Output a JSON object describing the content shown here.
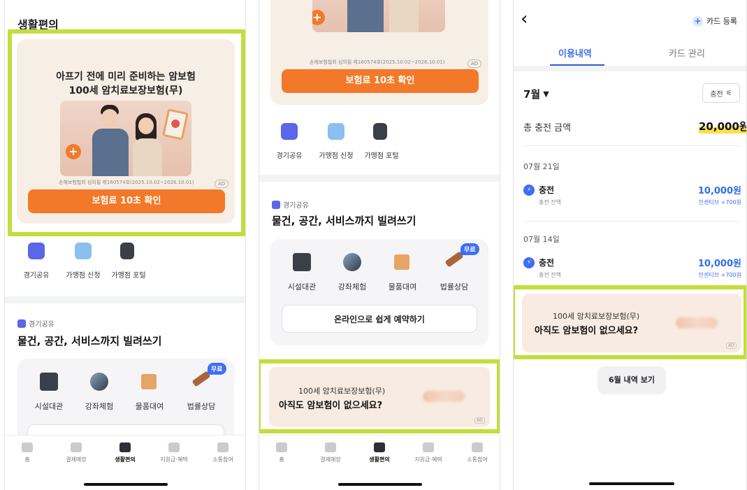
{
  "panel1": {
    "title": "생활편의",
    "ad": {
      "line1": "아프기 전에 미리 준비하는 암보험",
      "line2": "100세 암치료보장보험(무)",
      "caption": "손해보험협회 심의필 제160574호(2025.10.02~2026.10.01)",
      "badge": "AD",
      "cta": "보험료 10초 확인"
    },
    "quick": [
      "경기공유",
      "가맹점 신청",
      "가맹점 포털"
    ],
    "section_tag": "경기공유",
    "section_title": "물건, 공간, 서비스까지 빌려쓰기",
    "services": [
      "시설대관",
      "강좌체험",
      "물품대여",
      "법률상담"
    ],
    "free_badge": "무료"
  },
  "panel2": {
    "ad": {
      "caption": "손해보험협회 심의필 제160574호(2025.10.02~2026.10.01)",
      "badge": "AD",
      "cta": "보험료 10초 확인"
    },
    "quick": [
      "경기공유",
      "가맹점 신청",
      "가맹점 포털"
    ],
    "section_tag": "경기공유",
    "section_title": "물건, 공간, 서비스까지 빌려쓰기",
    "services": [
      "시설대관",
      "강좌체험",
      "물품대여",
      "법률상담"
    ],
    "free_badge": "무료",
    "reserve": "온라인으로 쉽게 예약하기",
    "banner": {
      "line1": "100세 암치료보장보험(무)",
      "line2": "아직도 암보험이 없으세요?",
      "badge": "AD"
    }
  },
  "tabs": [
    "홈",
    "결제매장",
    "생활편의",
    "지원금·혜택",
    "소통참여"
  ],
  "active_tab": "생활편의",
  "panel3": {
    "back": "‹",
    "register": "카드 등록",
    "tabs": [
      "이용내역",
      "카드 관리"
    ],
    "month": "7월",
    "filter": "충전",
    "total_label": "총 충전 금액",
    "total_value": "20,000원",
    "groups": [
      {
        "date": "07월 21일",
        "title": "충전",
        "sub": "충전 잔액",
        "amount": "10,000원",
        "bonus": "인센티브 +700원"
      },
      {
        "date": "07월 14일",
        "title": "충전",
        "sub": "충전 잔액",
        "amount": "10,000원",
        "bonus": "인센티브 +700원"
      }
    ],
    "banner": {
      "line1": "100세 암치료보장보험(무)",
      "line2": "아직도 암보험이 없으세요?",
      "badge": "AD"
    },
    "prev_month": "6월 내역 보기"
  },
  "colors": {
    "accent_orange": "#f3792a",
    "accent_blue": "#3d6ef5",
    "highlight": "#c4dd3b",
    "amount_blue": "#2f6fe4"
  }
}
